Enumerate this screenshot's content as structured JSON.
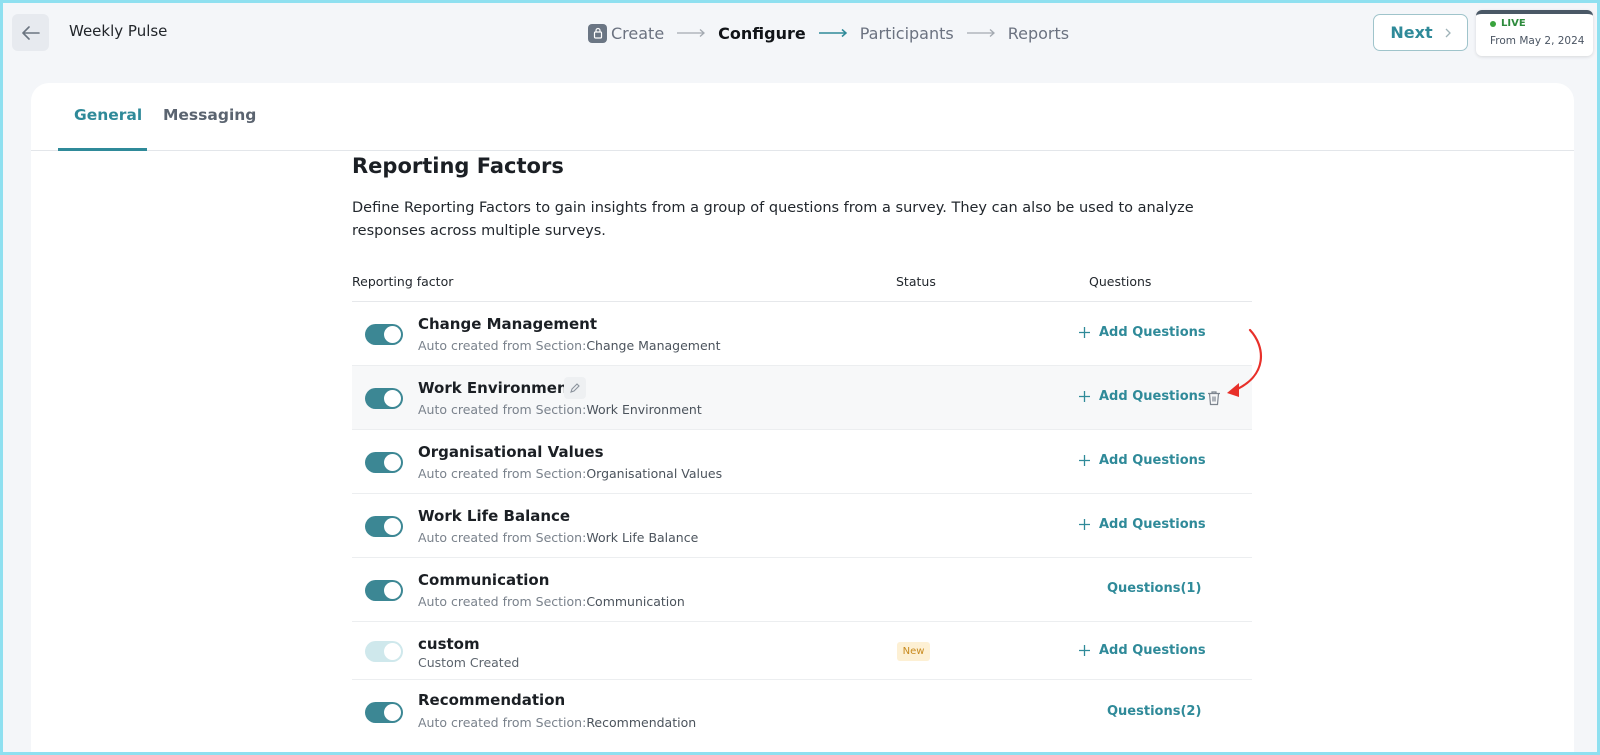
{
  "header": {
    "survey_title": "Weekly Pulse",
    "steps": [
      "Create",
      "Configure",
      "Participants",
      "Reports"
    ],
    "active_step": "Configure",
    "next_label": "Next",
    "status_label": "LIVE",
    "status_date": "From May 2, 2024"
  },
  "tabs": [
    {
      "label": "General",
      "active": true
    },
    {
      "label": "Messaging",
      "active": false
    }
  ],
  "section": {
    "title": "Reporting Factors",
    "description": "Define Reporting Factors to gain insights from a group of questions from a survey. They can also be used to analyze responses across multiple surveys."
  },
  "table": {
    "columns": [
      "Reporting factor",
      "Status",
      "Questions"
    ],
    "rows": [
      {
        "name": "Change Management",
        "sub_prefix": "Auto created from Section:",
        "sub_section": "Change Management",
        "enabled": true,
        "action": "Add Questions"
      },
      {
        "name": "Work Environment",
        "sub_prefix": "Auto created from Section:",
        "sub_section": "Work Environment",
        "enabled": true,
        "action": "Add Questions",
        "hovered": true
      },
      {
        "name": "Organisational Values",
        "sub_prefix": "Auto created from Section:",
        "sub_section": "Organisational Values",
        "enabled": true,
        "action": "Add Questions"
      },
      {
        "name": "Work Life Balance",
        "sub_prefix": "Auto created from Section:",
        "sub_section": "Work Life Balance",
        "enabled": true,
        "action": "Add Questions"
      },
      {
        "name": "Communication",
        "sub_prefix": "Auto created from Section:",
        "sub_section": "Communication",
        "enabled": true,
        "action": "Questions(1)"
      },
      {
        "name": "custom",
        "sub_prefix": "Custom Created",
        "sub_section": "",
        "enabled": false,
        "status_badge": "New",
        "action": "Add Questions"
      },
      {
        "name": "Recommendation",
        "sub_prefix": "Auto created from Section:",
        "sub_section": "Recommendation",
        "enabled": true,
        "action": "Questions(2)"
      }
    ]
  },
  "colors": {
    "accent": "#2f8a99",
    "toggle_on": "#3c8794",
    "toggle_off": "#cfe8ec",
    "annotation_arrow": "#e8302a"
  },
  "icons": {
    "back": "arrow-left-icon",
    "step": "lock-icon",
    "edit": "pencil-icon",
    "delete": "trash-icon",
    "add": "plus-icon"
  }
}
